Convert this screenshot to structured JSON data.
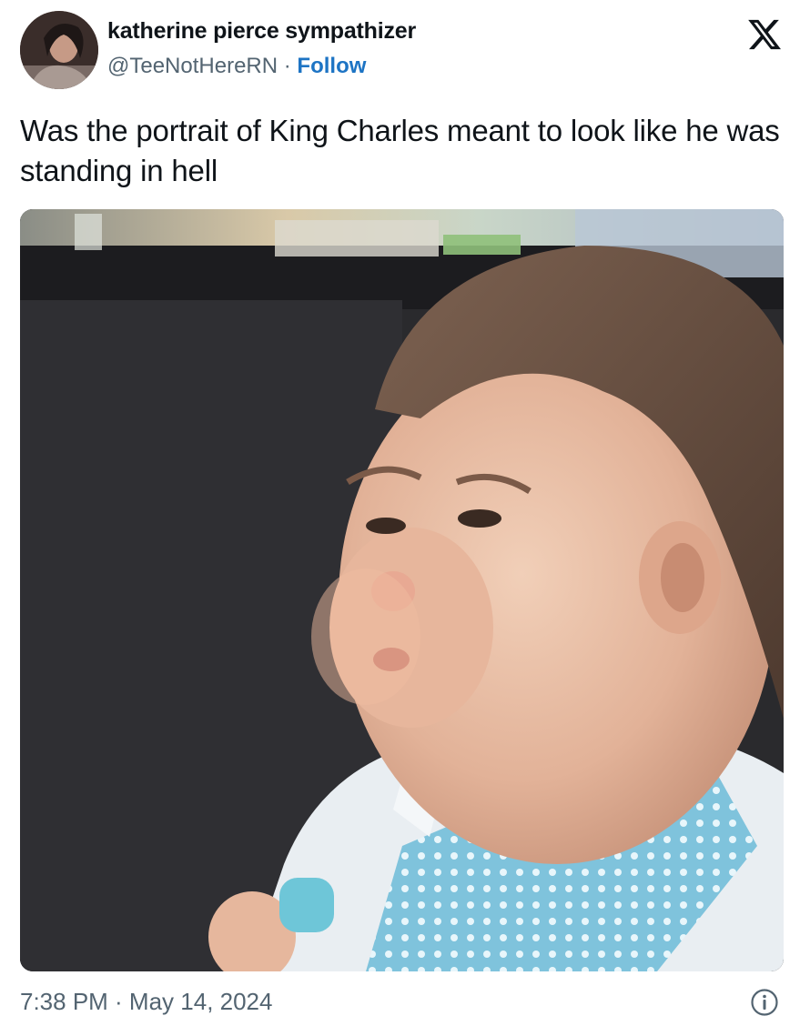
{
  "author": {
    "display_name": "katherine pierce sympathizer",
    "handle": "@TeeNotHereRN",
    "separator": " · ",
    "follow_label": "Follow"
  },
  "tweet": {
    "text": "Was the portrait of King Charles meant to look like he was standing in hell"
  },
  "media": {
    "subject": "toddler frowning with puffed cheeks, wearing a light-blue polka-dot collared shirt"
  },
  "footer": {
    "timestamp": "7:38 PM · May 14, 2024"
  },
  "icons": {
    "platform": "x-logo-icon",
    "info": "info-icon"
  },
  "colors": {
    "follow": "#1d74c4",
    "secondary_text": "#536471",
    "primary_text": "#0f1419"
  }
}
